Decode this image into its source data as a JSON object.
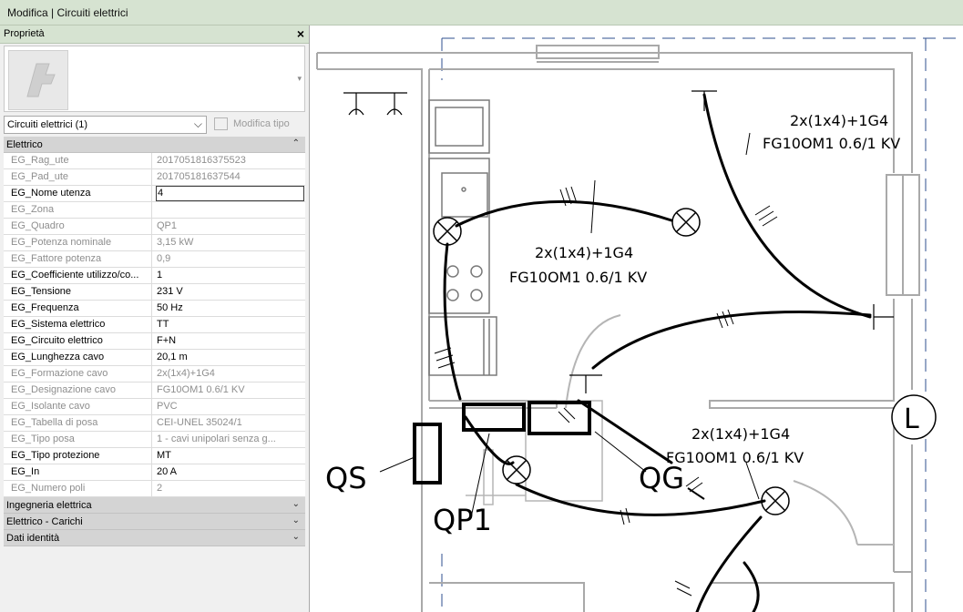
{
  "window": {
    "title": "Modifica | Circuiti elettrici"
  },
  "properties": {
    "header": "Proprietà",
    "close_icon": "×",
    "dropdown_arrow": "▾",
    "selector": "Circuiti elettrici (1)",
    "selector_chevron": "⌵",
    "edit_type": "Modifica tipo",
    "groups": [
      {
        "label": "Elettrico",
        "icon": "⌃",
        "expanded": true,
        "rows": [
          {
            "key": "EG_Rag_ute",
            "value": "20170518163​75523",
            "ro": true
          },
          {
            "key": "EG_Pad_ute",
            "value": "201705181637544",
            "ro": true
          },
          {
            "key": "EG_Nome utenza",
            "value": "4",
            "ro": false,
            "edit": true
          },
          {
            "key": "EG_Zona",
            "value": "",
            "ro": true
          },
          {
            "key": "EG_Quadro",
            "value": "QP1",
            "ro": true
          },
          {
            "key": "EG_Potenza nominale",
            "value": "3,15 kW",
            "ro": true
          },
          {
            "key": "EG_Fattore potenza",
            "value": "0,9",
            "ro": true
          },
          {
            "key": "EG_Coefficiente utilizzo/co...",
            "value": "1",
            "ro": false
          },
          {
            "key": "EG_Tensione",
            "value": "231 V",
            "ro": false
          },
          {
            "key": "EG_Frequenza",
            "value": "50 Hz",
            "ro": false
          },
          {
            "key": "EG_Sistema elettrico",
            "value": "TT",
            "ro": false
          },
          {
            "key": "EG_Circuito elettrico",
            "value": "F+N",
            "ro": false
          },
          {
            "key": "EG_Lunghezza cavo",
            "value": "20,1 m",
            "ro": false
          },
          {
            "key": "EG_Formazione cavo",
            "value": "2x(1x4)+1G4",
            "ro": true
          },
          {
            "key": "EG_Designazione cavo",
            "value": "FG10OM1 0.6/1 KV",
            "ro": true
          },
          {
            "key": "EG_Isolante cavo",
            "value": "PVC",
            "ro": true
          },
          {
            "key": "EG_Tabella di posa",
            "value": "CEI-UNEL 35024/1",
            "ro": true
          },
          {
            "key": "EG_Tipo posa",
            "value": "1 - cavi unipolari senza g...",
            "ro": true
          },
          {
            "key": "EG_Tipo protezione",
            "value": "MT",
            "ro": false
          },
          {
            "key": "EG_In",
            "value": "20 A",
            "ro": false
          },
          {
            "key": "EG_Numero poli",
            "value": "2",
            "ro": true
          }
        ]
      },
      {
        "label": "Ingegneria elettrica",
        "icon": "⌄",
        "expanded": false,
        "rows": []
      },
      {
        "label": "Elettrico - Carichi",
        "icon": "⌄",
        "expanded": false,
        "rows": []
      },
      {
        "label": "Dati identità",
        "icon": "⌄",
        "expanded": false,
        "rows": []
      }
    ]
  },
  "drawing": {
    "cable1_formation": "2x(1x4)+1G4",
    "cable1_designation": "FG10OM1 0.6/1 KV",
    "cable2_formation": "2x(1x4)+1G4",
    "cable2_designation": "FG10OM1 0.6/1 KV",
    "cable3_formation": "2x(1x4)+1G4",
    "cable3_designation": "FG10OM1 0.6/1 KV",
    "label_qs": "QS",
    "label_qp1": "QP1",
    "label_qg": "QG",
    "label_l": "L"
  }
}
